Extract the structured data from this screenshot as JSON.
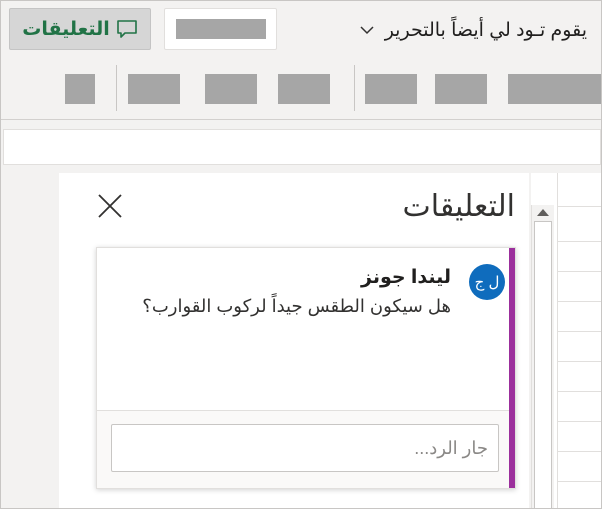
{
  "ribbon": {
    "edit_status": "يقوم تـود لي أيضاً بالتحرير",
    "comments_button": "التعليقات"
  },
  "pane": {
    "title": "التعليقات",
    "comment": {
      "avatar_initials": "ل ج",
      "author": "ليندا جونز",
      "message": "هل سيكون الطقس جيداً لركوب القوارب؟",
      "reply_placeholder": "جار الرد..."
    }
  },
  "colors": {
    "accent_green": "#217346",
    "avatar_blue": "#0f6cbd",
    "card_accent_purple": "#9b2f9c"
  }
}
